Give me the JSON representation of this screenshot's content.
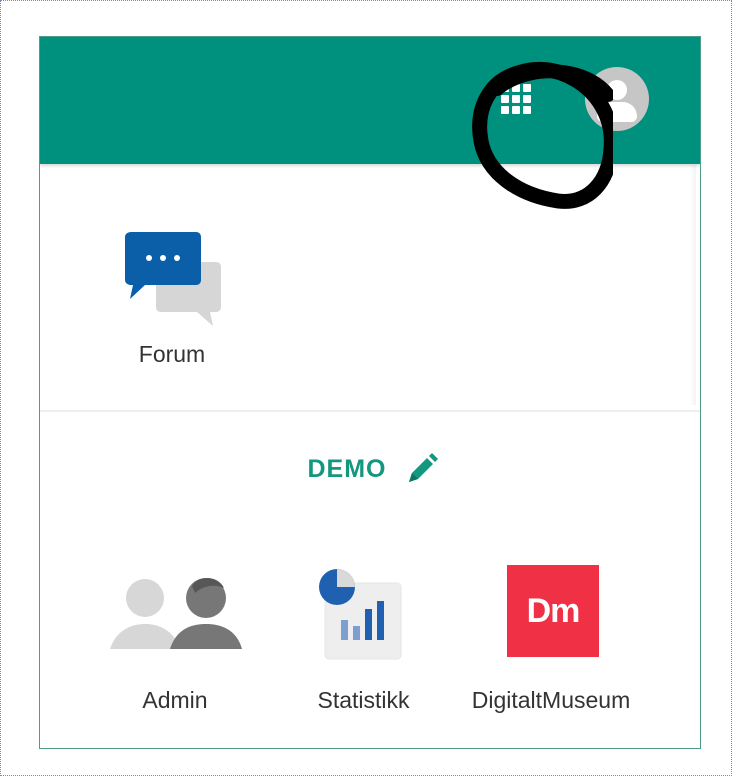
{
  "header": {
    "background_color": "#00907e",
    "apps_icon": "grid-apps-icon",
    "profile_icon": "account-circle-icon"
  },
  "apps": {
    "top_section": [
      {
        "label": "Forum",
        "icon": "forum-chat-icon",
        "icon_color": "#0b5ea8"
      }
    ],
    "demo_section": {
      "title": "DEMO",
      "title_color": "#14977f",
      "edit_icon": "pencil-edit-icon",
      "items": [
        {
          "label": "Admin",
          "icon": "people-admin-icon"
        },
        {
          "label": "Statistikk",
          "icon": "statistics-chart-icon"
        },
        {
          "label": "DigitaltMuseum",
          "logo_text": "Dm",
          "logo_color": "#ef3045"
        }
      ]
    }
  },
  "annotation": {
    "shape": "black-circle",
    "target": "apps-button"
  }
}
